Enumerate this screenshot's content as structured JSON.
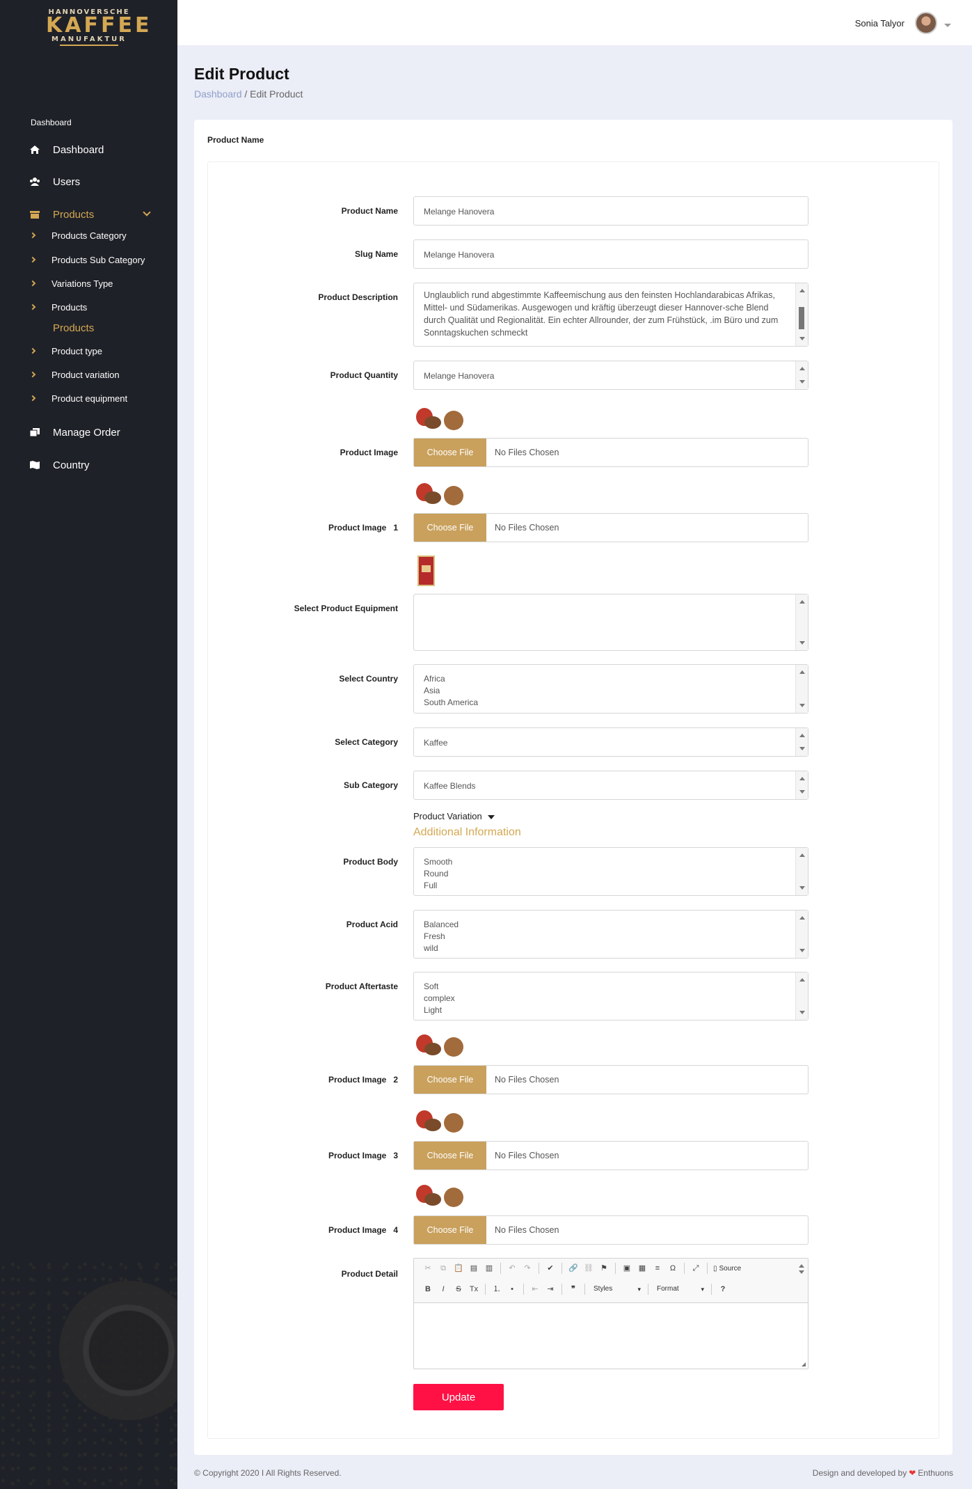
{
  "brand": {
    "line1": "HANNOVERSCHE",
    "line2": "KAFFEE",
    "line3": "MANUFAKTUR"
  },
  "sidebar": {
    "section_heading": "Dashboard",
    "items": [
      {
        "label": "Dashboard",
        "icon": "home-icon"
      },
      {
        "label": "Users",
        "icon": "users-icon"
      },
      {
        "label": "Products",
        "icon": "box-icon"
      },
      {
        "label": "Manage Order",
        "icon": "clipboard-icon"
      },
      {
        "label": "Country",
        "icon": "map-icon"
      }
    ],
    "products_sub": [
      "Products Category",
      "Products Sub Category",
      "Variations Type",
      "Products"
    ],
    "products_heading": "Products",
    "products_sub2": [
      "Product type",
      "Product variation",
      "Product equipment"
    ]
  },
  "topbar": {
    "user_name": "Sonia Talyor"
  },
  "page": {
    "title": "Edit Product",
    "breadcrumb_link": "Dashboard",
    "breadcrumb_sep": " / ",
    "breadcrumb_current": "Edit Product"
  },
  "card": {
    "title": "Product Name"
  },
  "form": {
    "product_name": {
      "label": "Product Name",
      "value": "Melange Hanovera"
    },
    "slug": {
      "label": "Slug Name",
      "value": "Melange Hanovera"
    },
    "description": {
      "label": "Product Description",
      "value": "Unglaublich rund abgestimmte Kaffeemischung aus den feinsten Hochlandarabicas Afrikas, Mittel- und Südamerikas. Ausgewogen und kräftig überzeugt dieser Hannover-sche Blend durch Qualität und Regionalität. Ein echter Allrounder, der zum Frühstück, .im Büro und zum Sonntagskuchen schmeckt"
    },
    "quantity": {
      "label": "Product Quantity",
      "value": "Melange Hanovera"
    },
    "image": {
      "label": "Product Image",
      "button": "Choose File",
      "status": "No Files Chosen"
    },
    "image1": {
      "label": "Product Image   1",
      "button": "Choose File",
      "status": "No Files Chosen"
    },
    "equipment": {
      "label": "Select Product Equipment"
    },
    "country": {
      "label": "Select Country",
      "options": [
        "Africa",
        "Asia",
        "South America"
      ]
    },
    "category": {
      "label": "Select Category",
      "value": "Kaffee"
    },
    "sub_category": {
      "label": "Sub Category",
      "value": "Kaffee Blends"
    },
    "variation_toggle": "Product Variation",
    "additional_info": "Additional Information",
    "body": {
      "label": "Product Body",
      "options": [
        "Smooth",
        "Round",
        "Full"
      ]
    },
    "acid": {
      "label": "Product Acid",
      "options": [
        "Balanced",
        "Fresh",
        "wild"
      ]
    },
    "aftertaste": {
      "label": "Product Aftertaste",
      "options": [
        "Soft",
        "complex",
        "Light"
      ]
    },
    "image2": {
      "label": "Product Image   2",
      "button": "Choose File",
      "status": "No Files Chosen"
    },
    "image3": {
      "label": "Product Image   3",
      "button": "Choose File",
      "status": "No Files Chosen"
    },
    "image4": {
      "label": "Product Image   4",
      "button": "Choose File",
      "status": "No Files Chosen"
    },
    "detail": {
      "label": "Product Detail",
      "source_label": "Source",
      "styles_label": "Styles",
      "format_label": "Format"
    },
    "update_label": "Update"
  },
  "footer": {
    "copyright": "© Copyright 2020 I All Rights Reserved.",
    "credit_prefix": "Design and developed by",
    "credit_name": "Enthuons"
  }
}
